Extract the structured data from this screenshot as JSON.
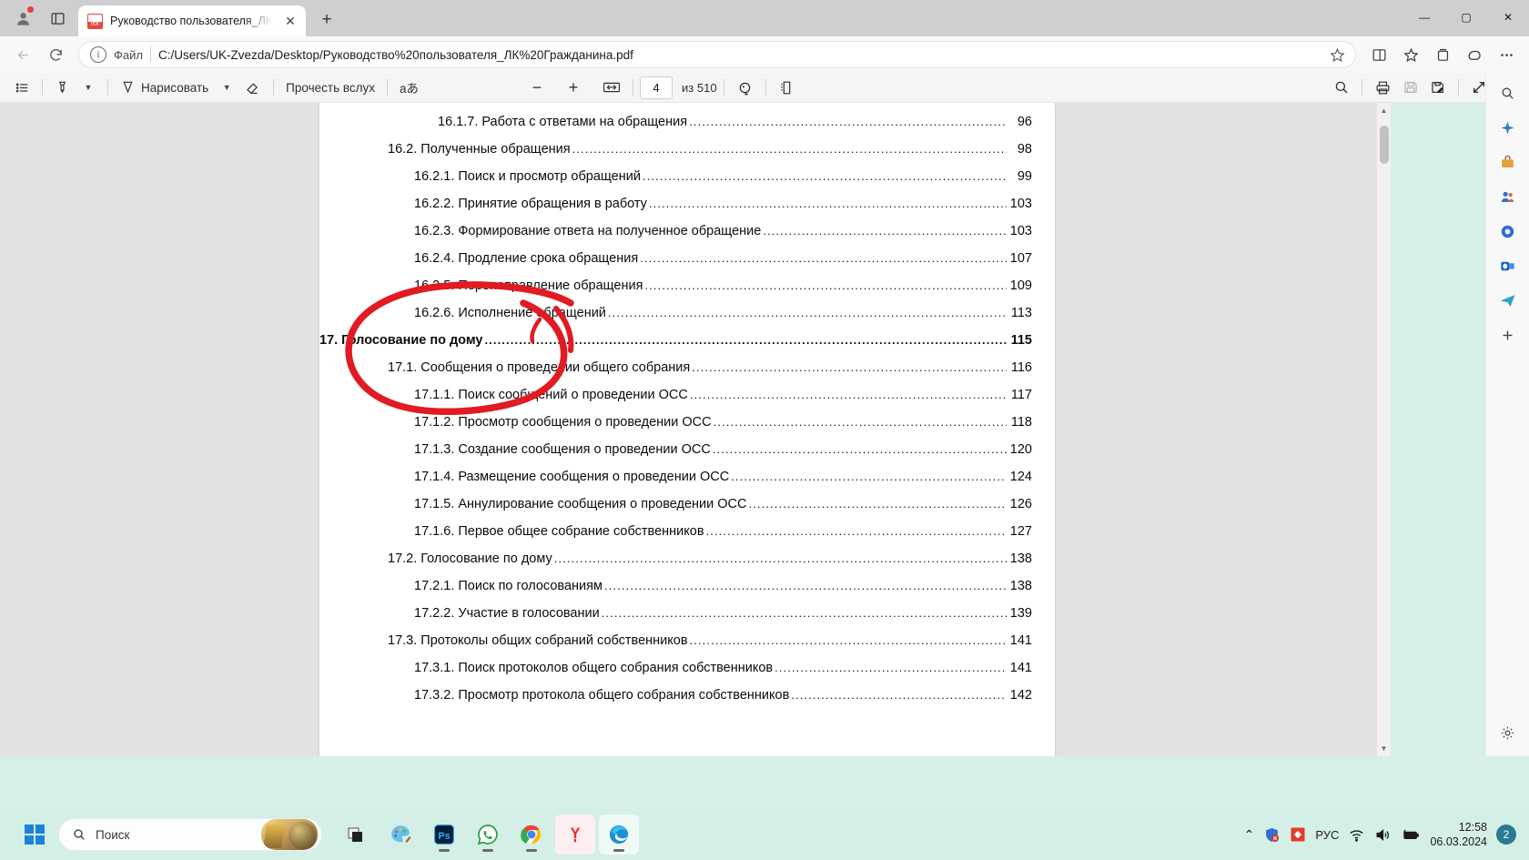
{
  "browser": {
    "tab": {
      "title": "Руководство пользователя_ЛК Г",
      "favicon": "pdf-file-icon",
      "close_label": "✕"
    },
    "new_tab_label": "+",
    "window_controls": {
      "minimize": "—",
      "maximize": "▢",
      "close": "✕"
    },
    "address": {
      "scheme_label": "Файл",
      "url": "C:/Users/UK-Zvezda/Desktop/Руководство%20пользователя_ЛК%20Гражданина.pdf",
      "info_glyph": "i"
    }
  },
  "pdf_toolbar": {
    "toc_label": "Оглавление",
    "highlight_label": "Выделение",
    "draw_label": "Нарисовать",
    "erase_label": "Ластик",
    "read_aloud_label": "Прочесть вслух",
    "text_style_label": "aあ",
    "zoom_out_label": "−",
    "zoom_in_label": "+",
    "fit_label": "По ширине страницы",
    "current_page": "4",
    "page_count_label": "из 510",
    "rotate_label": "Повернуть",
    "layout_label": "Макет страницы",
    "search_label": "Поиск",
    "print_label": "Печать",
    "save_label": "Сохранить",
    "save_as_label": "Сохранить как",
    "fullscreen_label": "Во весь экран",
    "settings_label": "Параметры"
  },
  "document": {
    "toc": [
      {
        "level": 3,
        "label": "16.1.7. Работа с ответами на обращения",
        "page": "96",
        "bold": false
      },
      {
        "level": 1,
        "label": "16.2. Полученные обращения",
        "page": "98",
        "bold": false
      },
      {
        "level": 2,
        "label": "16.2.1. Поиск и просмотр обращений",
        "page": "99",
        "bold": false
      },
      {
        "level": 2,
        "label": "16.2.2. Принятие обращения в работу",
        "page": "103",
        "bold": false
      },
      {
        "level": 2,
        "label": "16.2.3. Формирование ответа на полученное обращение",
        "page": "103",
        "bold": false
      },
      {
        "level": 2,
        "label": "16.2.4. Продление срока обращения",
        "page": "107",
        "bold": false
      },
      {
        "level": 2,
        "label": "16.2.5. Перенаправление обращения",
        "page": "109",
        "bold": false
      },
      {
        "level": 2,
        "label": "16.2.6. Исполнение обращений",
        "page": "113",
        "bold": false
      },
      {
        "level": 0,
        "label": "17. Голосование по дому",
        "page": "115",
        "bold": true
      },
      {
        "level": 1,
        "label": "17.1. Сообщения о проведении общего собрания",
        "page": "116",
        "bold": false
      },
      {
        "level": 2,
        "label": "17.1.1. Поиск сообщений о проведении ОСС",
        "page": "117",
        "bold": false
      },
      {
        "level": 2,
        "label": "17.1.2. Просмотр сообщения о проведении ОСС",
        "page": "118",
        "bold": false
      },
      {
        "level": 2,
        "label": "17.1.3. Создание сообщения о проведении ОСС",
        "page": "120",
        "bold": false
      },
      {
        "level": 2,
        "label": "17.1.4. Размещение сообщения о проведении ОСС",
        "page": "124",
        "bold": false
      },
      {
        "level": 2,
        "label": "17.1.5. Аннулирование сообщения о проведении ОСС",
        "page": "126",
        "bold": false
      },
      {
        "level": 2,
        "label": "17.1.6. Первое общее собрание собственников",
        "page": "127",
        "bold": false
      },
      {
        "level": 1,
        "label": "17.2.  Голосование по дому ",
        "page": "138",
        "bold": false
      },
      {
        "level": 2,
        "label": "17.2.1. Поиск по голосованиям",
        "page": "138",
        "bold": false
      },
      {
        "level": 2,
        "label": "17.2.2. Участие в голосовании",
        "page": "139",
        "bold": false
      },
      {
        "level": 1,
        "label": "17.3. Протоколы общих собраний собственников",
        "page": "141",
        "bold": false
      },
      {
        "level": 2,
        "label": "17.3.1. Поиск протоколов общего собрания собственников",
        "page": "141",
        "bold": false
      },
      {
        "level": 2,
        "label": "17.3.2. Просмотр протокола общего собрания собственников",
        "page": "142",
        "bold": false
      }
    ],
    "annotation": {
      "kind": "red-ink-ellipse",
      "color": "#e01b22",
      "encircles": "17. Голосование по дому"
    }
  },
  "sidebar": {
    "items": [
      {
        "name": "copilot-icon",
        "glyph": "✦"
      },
      {
        "name": "shopping-icon",
        "glyph": "🧳"
      },
      {
        "name": "tools-icon",
        "glyph": "👥"
      },
      {
        "name": "games-icon",
        "glyph": "◉"
      },
      {
        "name": "outlook-icon",
        "glyph": "O"
      },
      {
        "name": "office-icon",
        "glyph": "✈"
      },
      {
        "name": "add-icon",
        "glyph": "＋"
      },
      {
        "name": "settings-icon",
        "glyph": "⚙"
      }
    ]
  },
  "taskbar": {
    "search_placeholder": "Поиск",
    "apps": [
      {
        "name": "taskview-icon",
        "label": "Представление задач"
      },
      {
        "name": "paint-icon",
        "label": "Paint"
      },
      {
        "name": "photoshop-icon",
        "label": "Ps"
      },
      {
        "name": "whatsapp-icon",
        "label": "WhatsApp"
      },
      {
        "name": "chrome-icon",
        "label": "Google Chrome"
      },
      {
        "name": "yandex-icon",
        "label": "Y"
      },
      {
        "name": "edge-icon",
        "label": "Microsoft Edge"
      }
    ],
    "tray": {
      "chevron": "⌃",
      "defender_label": "Защитник Windows",
      "language": "РУС",
      "time": "12:58",
      "date": "06.03.2024",
      "notification_count": "2"
    }
  },
  "colors": {
    "accent_red": "#e01b22",
    "taskbar": "#d4efe6",
    "tabstrip": "#cfcfcf",
    "viewer_bg": "#e2e2e2"
  }
}
